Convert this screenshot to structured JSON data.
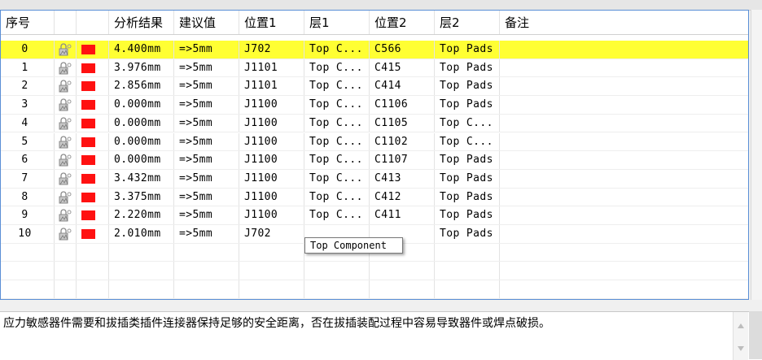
{
  "columns": {
    "index": "序号",
    "result": "分析结果",
    "suggested": "建议值",
    "pos1": "位置1",
    "layer1": "层1",
    "pos2": "位置2",
    "layer2": "层2",
    "remark": "备注"
  },
  "rows": [
    {
      "index": "0",
      "result": "4.400mm",
      "suggested": "=>5mm",
      "pos1": "J702",
      "layer1": "Top C...",
      "pos2": "C566",
      "layer2": "Top Pads",
      "remark": "",
      "selected": true
    },
    {
      "index": "1",
      "result": "3.976mm",
      "suggested": "=>5mm",
      "pos1": "J1101",
      "layer1": "Top C...",
      "pos2": "C415",
      "layer2": "Top Pads",
      "remark": ""
    },
    {
      "index": "2",
      "result": "2.856mm",
      "suggested": "=>5mm",
      "pos1": "J1101",
      "layer1": "Top C...",
      "pos2": "C414",
      "layer2": "Top Pads",
      "remark": ""
    },
    {
      "index": "3",
      "result": "0.000mm",
      "suggested": "=>5mm",
      "pos1": "J1100",
      "layer1": "Top C...",
      "pos2": "C1106",
      "layer2": "Top Pads",
      "remark": ""
    },
    {
      "index": "4",
      "result": "0.000mm",
      "suggested": "=>5mm",
      "pos1": "J1100",
      "layer1": "Top C...",
      "pos2": "C1105",
      "layer2": "Top C...",
      "remark": ""
    },
    {
      "index": "5",
      "result": "0.000mm",
      "suggested": "=>5mm",
      "pos1": "J1100",
      "layer1": "Top C...",
      "pos2": "C1102",
      "layer2": "Top C...",
      "remark": ""
    },
    {
      "index": "6",
      "result": "0.000mm",
      "suggested": "=>5mm",
      "pos1": "J1100",
      "layer1": "Top C...",
      "pos2": "C1107",
      "layer2": "Top Pads",
      "remark": ""
    },
    {
      "index": "7",
      "result": "3.432mm",
      "suggested": "=>5mm",
      "pos1": "J1100",
      "layer1": "Top C...",
      "pos2": "C413",
      "layer2": "Top Pads",
      "remark": ""
    },
    {
      "index": "8",
      "result": "3.375mm",
      "suggested": "=>5mm",
      "pos1": "J1100",
      "layer1": "Top C...",
      "pos2": "C412",
      "layer2": "Top Pads",
      "remark": ""
    },
    {
      "index": "9",
      "result": "2.220mm",
      "suggested": "=>5mm",
      "pos1": "J1100",
      "layer1": "Top C...",
      "pos2": "C411",
      "layer2": "Top Pads",
      "remark": ""
    },
    {
      "index": "10",
      "result": "2.010mm",
      "suggested": "=>5mm",
      "pos1": "J702",
      "layer1": "",
      "pos2": "",
      "layer2": "Top Pads",
      "remark": ""
    }
  ],
  "tooltip": "Top Component",
  "description": "应力敏感器件需要和拔插类插件连接器保持足够的安全距离，否在拔插装配过程中容易导致器件或焊点破损。",
  "colors": {
    "selected_row": "#ffff33",
    "status_swatch": "#ff1111",
    "grid_border": "#5a8fd6"
  },
  "icons": {
    "row_icon": "component-lock-icon",
    "status": "red-status-swatch"
  }
}
